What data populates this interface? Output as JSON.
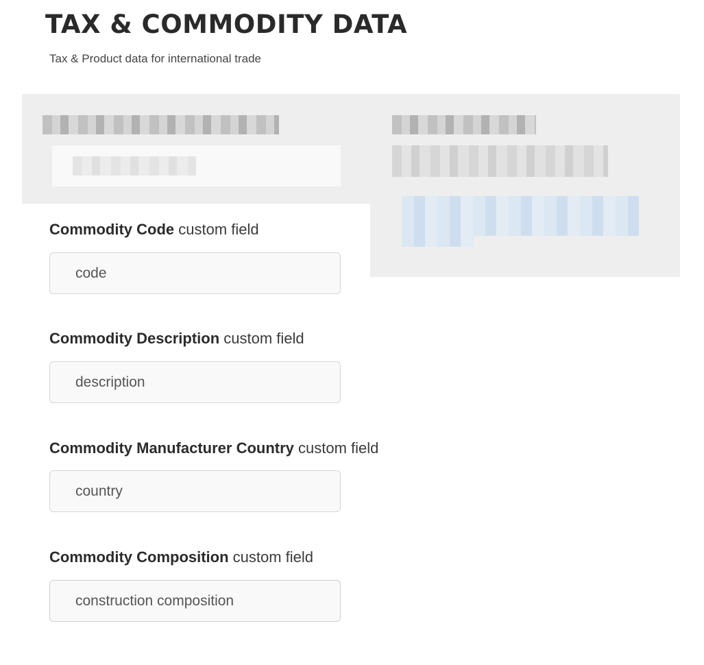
{
  "header": {
    "title": "TAX & COMMODITY DATA",
    "subtitle": "Tax & Product data for international trade"
  },
  "fields": [
    {
      "label_bold": "Commodity Code",
      "label_suffix": " custom field",
      "value": "code"
    },
    {
      "label_bold": "Commodity Description",
      "label_suffix": " custom field",
      "value": "description"
    },
    {
      "label_bold": "Commodity Manufacturer Country",
      "label_suffix": " custom field",
      "value": "country"
    },
    {
      "label_bold": "Commodity Composition",
      "label_suffix": " custom field",
      "value": "construction composition"
    }
  ]
}
